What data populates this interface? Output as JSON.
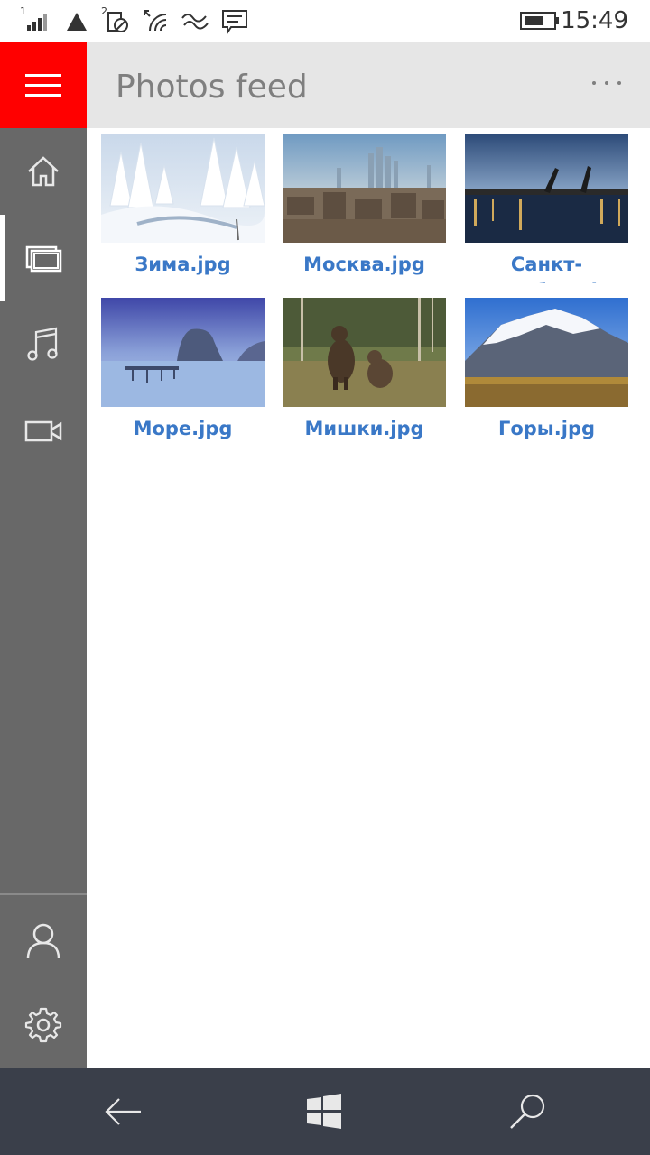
{
  "status_bar": {
    "time": "15:49",
    "sim1_label": "1",
    "sim2_label": "2"
  },
  "header": {
    "title": "Photos feed",
    "accent_color": "#ff0000"
  },
  "sidebar": {
    "items": [
      {
        "name": "home-icon",
        "active": false
      },
      {
        "name": "photos-icon",
        "active": true
      },
      {
        "name": "music-icon",
        "active": false
      },
      {
        "name": "video-icon",
        "active": false
      }
    ],
    "bottom_items": [
      {
        "name": "account-icon"
      },
      {
        "name": "settings-icon"
      }
    ]
  },
  "photos": [
    {
      "caption": "Зима.jpg",
      "scene": "winter"
    },
    {
      "caption": "Москва.jpg",
      "scene": "city"
    },
    {
      "caption": "Санкт-Петербург.jpg",
      "scene": "bridge"
    },
    {
      "caption": "Море.jpg",
      "scene": "sea"
    },
    {
      "caption": "Мишки.jpg",
      "scene": "bears"
    },
    {
      "caption": "Горы.jpg",
      "scene": "mountains"
    }
  ],
  "link_color": "#3a78c7"
}
